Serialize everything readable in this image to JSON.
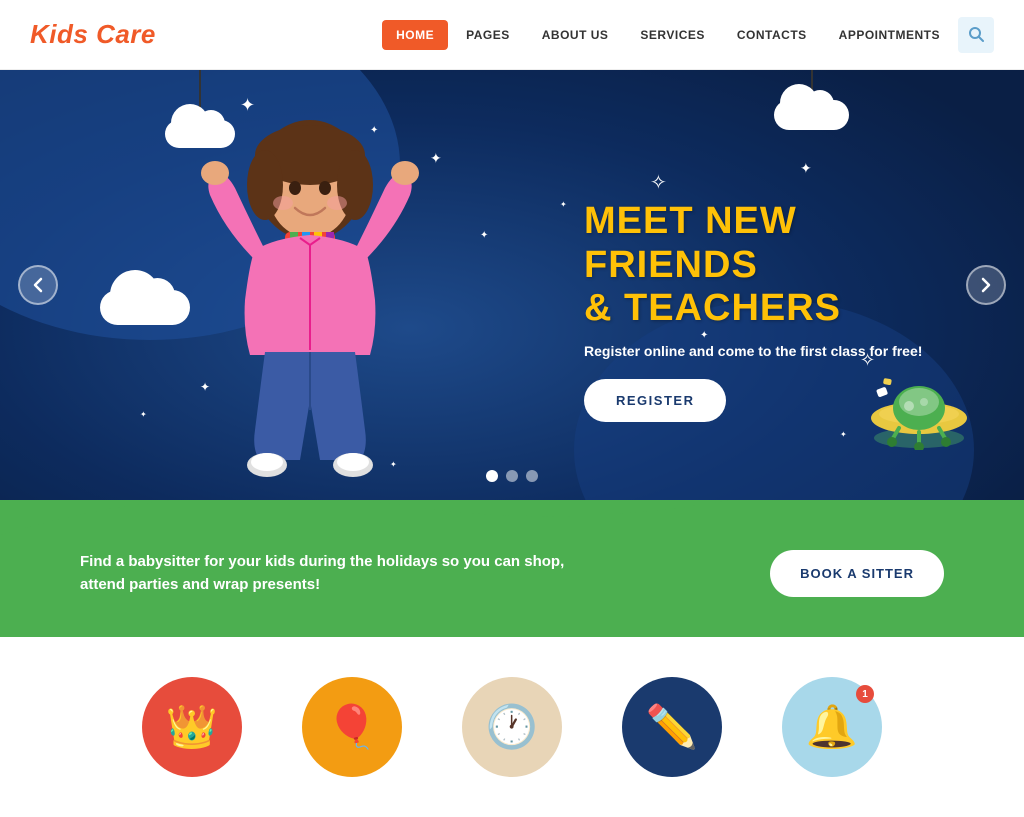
{
  "header": {
    "logo": "Kids Care",
    "nav": [
      {
        "id": "home",
        "label": "HOME",
        "active": true
      },
      {
        "id": "pages",
        "label": "PAGES",
        "active": false
      },
      {
        "id": "about",
        "label": "ABOUT US",
        "active": false
      },
      {
        "id": "services",
        "label": "SERVICES",
        "active": false
      },
      {
        "id": "contacts",
        "label": "CONTACTS",
        "active": false
      },
      {
        "id": "appointments",
        "label": "APPOINTMENTS",
        "active": false
      }
    ],
    "search_icon": "🔍"
  },
  "hero": {
    "headline_line1": "MEET NEW FRIENDS",
    "headline_line2": "& TEACHERS",
    "subtitle": "Register online and come to the first class for free!",
    "register_button": "REGISTER",
    "dots": [
      {
        "active": true
      },
      {
        "active": false
      },
      {
        "active": false
      }
    ],
    "prev_arrow": "‹",
    "next_arrow": "›"
  },
  "grass_section": {
    "text_line1": "Find a babysitter for your kids during the holidays so you can shop,",
    "text_line2": "attend parties and wrap presents!",
    "button_label": "BOOK A SITTER"
  },
  "icons_section": {
    "items": [
      {
        "id": "crown",
        "bg": "red",
        "icon": "👑",
        "badge": null
      },
      {
        "id": "balloon",
        "bg": "yellow",
        "icon": "🎈",
        "badge": null
      },
      {
        "id": "clock",
        "bg": "beige",
        "icon": "🕐",
        "badge": null
      },
      {
        "id": "pencil",
        "bg": "navy",
        "icon": "✏️",
        "badge": null
      },
      {
        "id": "bell",
        "bg": "light-blue",
        "icon": "🔔",
        "badge": "1"
      }
    ]
  }
}
